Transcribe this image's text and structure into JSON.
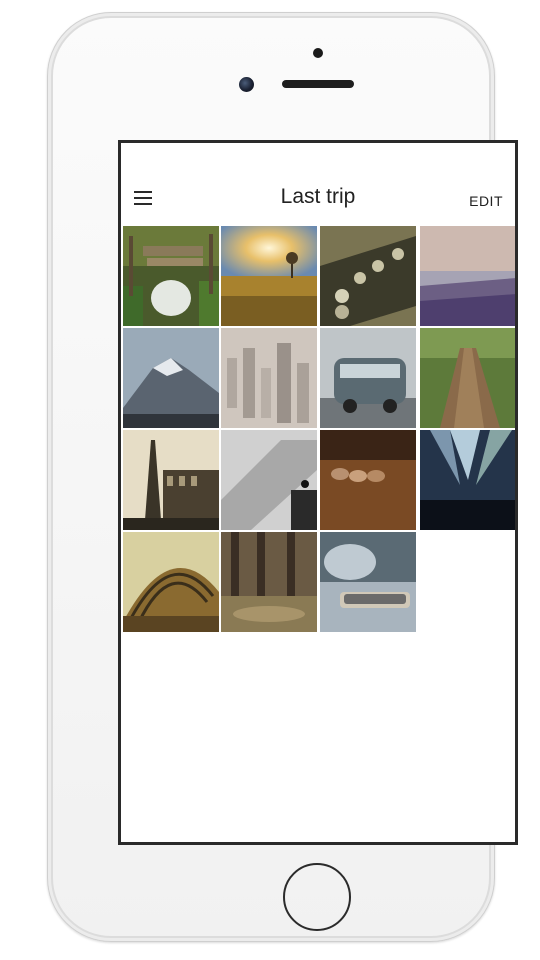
{
  "device": "iPhone",
  "header": {
    "title": "Last trip",
    "edit_label": "EDIT"
  },
  "menu_icon": "hamburger-menu-icon",
  "photos": [
    {
      "name": "wooden-pier-photo"
    },
    {
      "name": "sunrise-field-photo"
    },
    {
      "name": "guitar-headstock-photo"
    },
    {
      "name": "beach-shore-photo"
    },
    {
      "name": "snowy-mountain-photo"
    },
    {
      "name": "city-aerial-photo"
    },
    {
      "name": "vw-van-photo"
    },
    {
      "name": "forest-path-photo"
    },
    {
      "name": "eiffel-tower-photo"
    },
    {
      "name": "stone-steps-photo"
    },
    {
      "name": "shells-on-wood-photo"
    },
    {
      "name": "concert-lights-photo"
    },
    {
      "name": "glass-dome-photo"
    },
    {
      "name": "park-trees-photo"
    },
    {
      "name": "smartphone-photo"
    }
  ]
}
